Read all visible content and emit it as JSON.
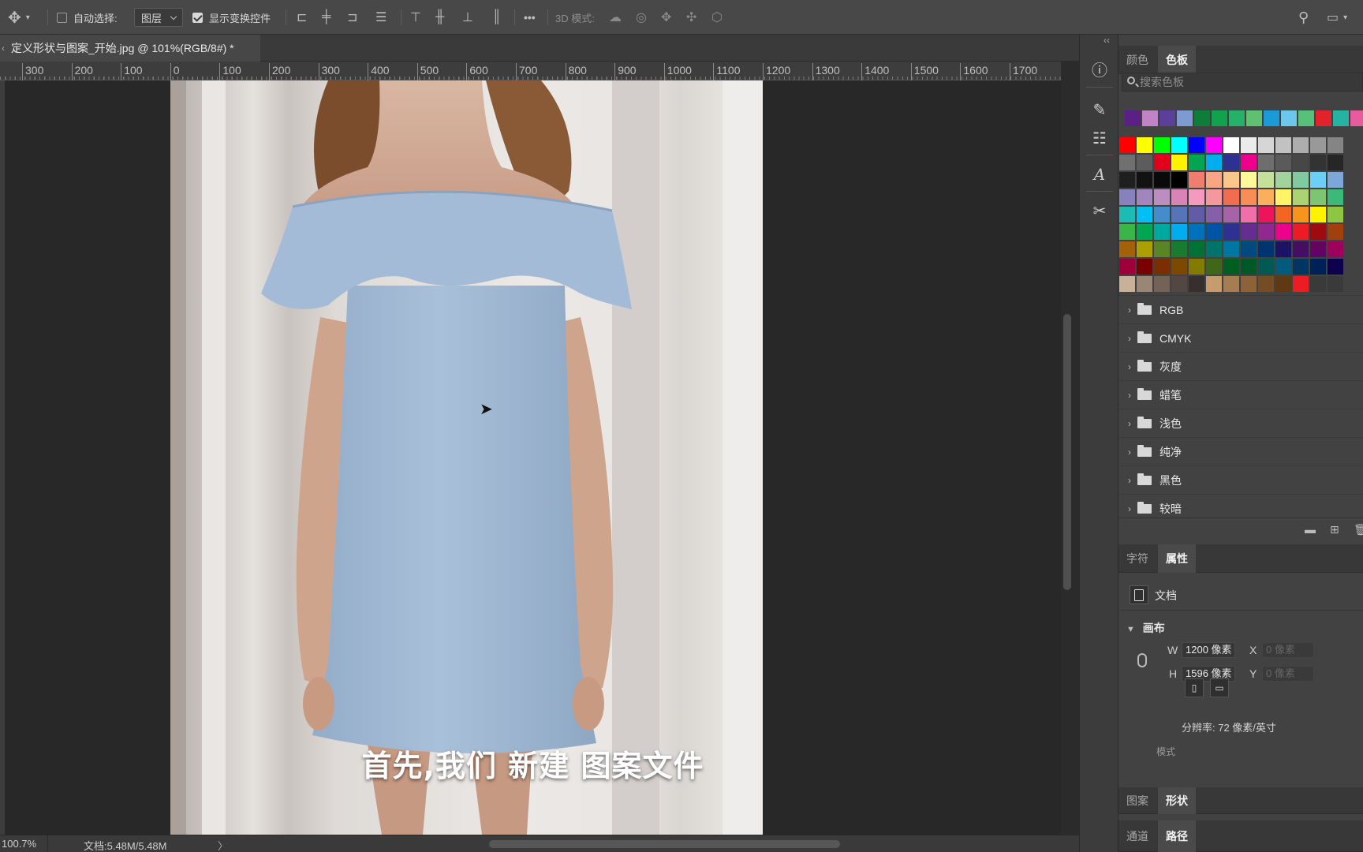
{
  "options_bar": {
    "auto_select_label": "自动选择:",
    "auto_select_checked": false,
    "layer_select_value": "图层",
    "show_transform_label": "显示变换控件",
    "show_transform_checked": true,
    "more_label": "•••",
    "mode_3d_label": "3D 模式:"
  },
  "document": {
    "tab_title": "定义形状与图案_开始.jpg @ 101%(RGB/8#) *"
  },
  "ruler": {
    "labels": [
      "300",
      "200",
      "100",
      "0",
      "100",
      "200",
      "300",
      "400",
      "500",
      "600",
      "700",
      "800",
      "900",
      "1000",
      "1100",
      "1200",
      "1300",
      "1400",
      "1500",
      "1600",
      "1700"
    ]
  },
  "subtitle": "首先,我们 新建 图案文件",
  "status": {
    "zoom": "100.7%",
    "doc_info": "文档:5.48M/5.48M",
    "arrow": "〉"
  },
  "panel_swatches": {
    "tabs": [
      "颜色",
      "色板"
    ],
    "active_tab": "色板",
    "search_placeholder": "搜索色板",
    "recent_colors": [
      "#5b1f86",
      "#c283c6",
      "#5c3f9a",
      "#7e9ad2",
      "#0e7d3a",
      "#10a24c",
      "#26b169",
      "#61bf72",
      "#1a9bd7",
      "#6cc7eb",
      "#57c17a",
      "#e3232b",
      "#27b3a3",
      "#e85b9e"
    ],
    "grid_rows": [
      [
        "#ff0000",
        "#ffff00",
        "#00ff00",
        "#00ffff",
        "#0000ff",
        "#ff00ff",
        "#ffffff",
        "#ebebeb",
        "#d6d6d6",
        "#c2c2c2",
        "#adadad",
        "#999999",
        "#858585"
      ],
      [
        "#707070",
        "#5c5c5c",
        "#e3001b",
        "#fff200",
        "#00a650",
        "#00aeef",
        "#2e3192",
        "#ec008c",
        "#6e6e6e",
        "#5a5a5a",
        "#474747",
        "#333333",
        "#262626"
      ],
      [
        "#1f1f1f",
        "#121212",
        "#0a0a0a",
        "#000000",
        "#f07e6e",
        "#f7a583",
        "#fbc68a",
        "#fff89a",
        "#c5e09b",
        "#a3d39c",
        "#7fcaa1",
        "#6ecff6",
        "#7da7d8"
      ],
      [
        "#8781bd",
        "#a186be",
        "#bc8dbf",
        "#d983b8",
        "#f49ac1",
        "#f5989d",
        "#f26c4f",
        "#f68e55",
        "#fbaf5c",
        "#fff467",
        "#acd372",
        "#7dc473",
        "#3cb878"
      ],
      [
        "#1cbbb4",
        "#00bff3",
        "#448ccb",
        "#5574b9",
        "#605ca8",
        "#8560a8",
        "#a763a8",
        "#f06eaa",
        "#ed145b",
        "#f26522",
        "#f7941d",
        "#fff200",
        "#8dc63f"
      ],
      [
        "#39b54a",
        "#00a651",
        "#00a99d",
        "#00aeef",
        "#0072bc",
        "#0054a6",
        "#2e3192",
        "#662d91",
        "#92278f",
        "#ec008c",
        "#ed1c24",
        "#9e0b0f",
        "#a0410d"
      ],
      [
        "#a36209",
        "#aba000",
        "#598527",
        "#197b30",
        "#007236",
        "#00746b",
        "#0076a3",
        "#004a80",
        "#003471",
        "#1b1464",
        "#440e62",
        "#630460",
        "#9e005d"
      ],
      [
        "#9e0039",
        "#790000",
        "#7b2e00",
        "#7d4900",
        "#827b00",
        "#406618",
        "#005e20",
        "#005826",
        "#005952",
        "#005b7f",
        "#003663",
        "#002157",
        "#0d004c"
      ],
      [
        "#c7b299",
        "#998675",
        "#736357",
        "#534741",
        "#362f2d",
        "#c69c6d",
        "#a67c52",
        "#8c6239",
        "#754c24",
        "#603913",
        "#ed1c24",
        "#3a3a3a",
        "#3a3a3a"
      ]
    ],
    "folders": [
      "RGB",
      "CMYK",
      "灰度",
      "蜡笔",
      "浅色",
      "纯净",
      "黑色",
      "较暗"
    ]
  },
  "panel_properties": {
    "tabs": [
      "字符",
      "属性"
    ],
    "active_tab": "属性",
    "doc_label": "文档",
    "canvas_header": "画布",
    "w_label": "W",
    "w_value": "1200 像素",
    "h_label": "H",
    "h_value": "1596 像素",
    "x_label": "X",
    "x_value": "0 像素",
    "y_label": "Y",
    "y_value": "0 像素",
    "resolution": "分辨率: 72 像素/英寸",
    "mode_partial": "模式"
  },
  "panel_bottom": {
    "tabs_1": [
      "图案",
      "形状"
    ],
    "active_1": "形状",
    "tabs_2": [
      "通道",
      "路径"
    ],
    "active_2": "路径"
  }
}
